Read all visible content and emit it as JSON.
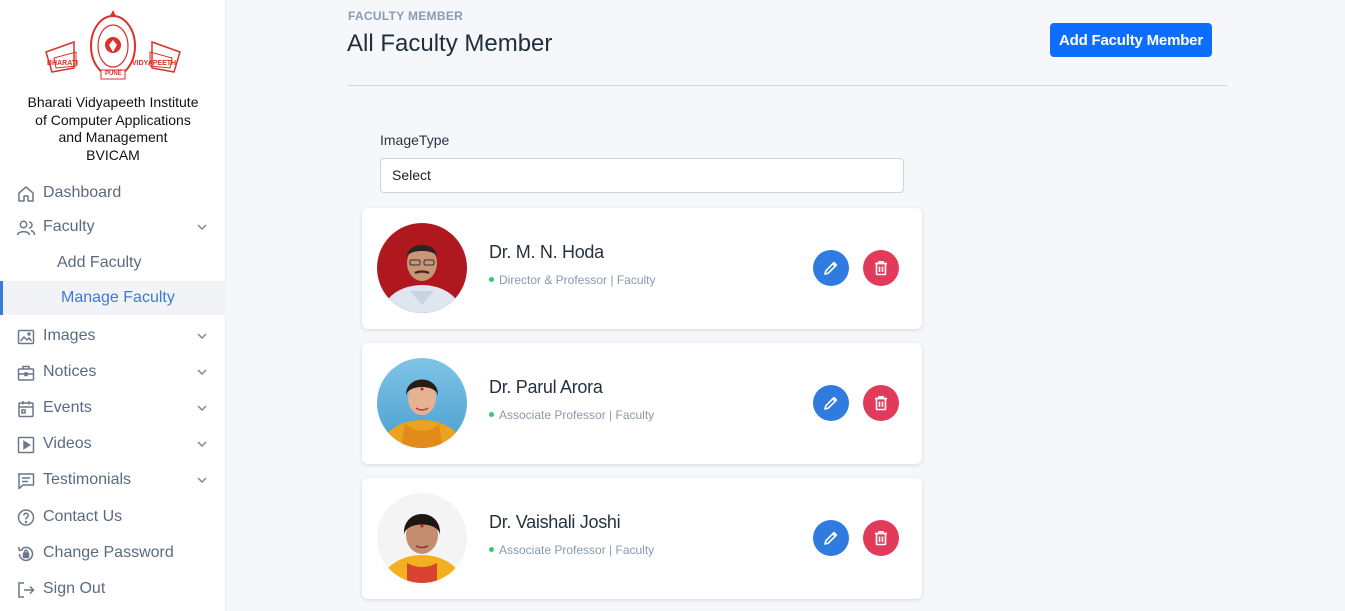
{
  "sidebar": {
    "logo": {
      "text_top": "BHARATI VIDYAPEETH",
      "text_left": "BHARATI",
      "text_right": "VIDYAPEETH",
      "text_bottom": "PUNE",
      "color": "#d8322b"
    },
    "org_name": [
      "Bharati Vidyapeeth Institute",
      "of Computer Applications",
      "and Management",
      "BVICAM"
    ],
    "items": [
      {
        "label": "Dashboard",
        "icon": "home-icon"
      },
      {
        "label": "Faculty",
        "icon": "users-icon",
        "expanded": true
      },
      {
        "label": "Add Faculty"
      },
      {
        "label": "Manage Faculty",
        "active": true
      },
      {
        "label": "Images",
        "icon": "image-icon"
      },
      {
        "label": "Notices",
        "icon": "briefcase-icon"
      },
      {
        "label": "Events",
        "icon": "calendar-icon"
      },
      {
        "label": "Videos",
        "icon": "video-icon"
      },
      {
        "label": "Testimonials",
        "icon": "message-icon"
      },
      {
        "label": "Contact Us",
        "icon": "help-icon"
      },
      {
        "label": "Change Password",
        "icon": "lock-reset-icon"
      },
      {
        "label": "Sign Out",
        "icon": "sign-out-icon"
      }
    ]
  },
  "header": {
    "eyebrow": "FACULTY MEMBER",
    "title": "All Faculty Member",
    "add_button": "Add Faculty Member"
  },
  "filter": {
    "label": "ImageType",
    "value": "Select"
  },
  "faculty": [
    {
      "name": "Dr. M. N. Hoda",
      "role": "Director & Professor | Faculty"
    },
    {
      "name": "Dr. Parul Arora",
      "role": "Associate Professor | Faculty"
    },
    {
      "name": "Dr. Vaishali Joshi",
      "role": "Associate Professor | Faculty"
    }
  ],
  "colors": {
    "primary": "#0d6efd",
    "edit": "#2f7be0",
    "delete": "#e23a5b",
    "status_dot": "#2ecc71",
    "active_nav": "#3c7bd4"
  }
}
